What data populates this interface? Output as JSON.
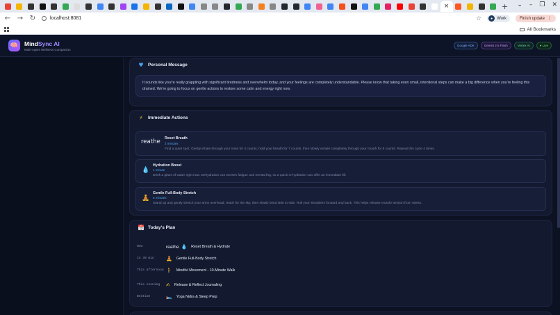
{
  "browser": {
    "url": "localhost:8081",
    "profile_label": "Work",
    "finish_update_label": "Finish update",
    "all_bookmarks_label": "All Bookmarks",
    "tab_favicon_colors": [
      "#ea4335",
      "#f4b400",
      "#333333",
      "#111111",
      "#333333",
      "#34a853",
      "#dddddd",
      "#333333",
      "#4285f4",
      "#333333",
      "#a142f4",
      "#1a73e8",
      "#f4b400",
      "#333333",
      "#0a66c2",
      "#111111",
      "#4285f4",
      "#888888",
      "#888888",
      "#24292f",
      "#34a853",
      "#888888",
      "#f48024",
      "#888888",
      "#24292f",
      "#24292f",
      "#4285f4",
      "#f06292",
      "#4285f4",
      "#f4511e",
      "#111111",
      "#4285f4",
      "#34a853",
      "#e91e63",
      "#ff0000",
      "#ea4335",
      "#333333",
      "#ffffff",
      "#ff5722",
      "#f4b400",
      "#333333",
      "#34a853"
    ],
    "active_tab_close": "×"
  },
  "app": {
    "name_part1": "Mind",
    "name_part2": "Sync AI",
    "subtitle": "Multi-Agent Wellness Companion",
    "badges": [
      "Google ADK",
      "Gemini 2.5 Flash",
      "Vertex AI",
      "● Live"
    ]
  },
  "personal_message": {
    "title": "Personal Message",
    "icon": "blue-heart-icon",
    "text": "It sounds like you're really grappling with significant tiredness and overwhelm today, and your feelings are completely understandable. Please know that taking even small, intentional steps can make a big difference when you're feeling this drained. We're going to focus on gentle actions to restore some calm and energy right now."
  },
  "immediate_actions": {
    "title": "Immediate Actions",
    "icon": "lightning-icon",
    "items": [
      {
        "icon_text": "reathe",
        "title": "Reset Breath",
        "duration": "2 minutes",
        "description": "Find a quiet spot. Gently inhale through your nose for 4 counts, hold your breath for 7 counts, then slowly exhale completely through your mouth for 8 counts. Repeat this cycle 4 times."
      },
      {
        "icon": "droplet-icon",
        "title": "Hydration Boost",
        "duration": "1 minute",
        "description": "Drink a glass of water right now. Dehydration can worsen fatigue and mental fog, so a quick re-hydration can offer an immediate lift."
      },
      {
        "icon": "yoga-icon",
        "title": "Gentle Full-Body Stretch",
        "duration": "5 minutes",
        "description": "Stand up and gently stretch your arms overhead, reach for the sky, then slowly bend side to side. Roll your shoulders forward and back. This helps release muscle tension from stress."
      }
    ]
  },
  "todays_plan": {
    "title": "Today's Plan",
    "icon": "calendar-icon",
    "rows": [
      {
        "time": "Now",
        "icon_text": "reathe",
        "icon": "droplet-icon",
        "label": "Reset Breath & Hydrate"
      },
      {
        "time": "In 30 min",
        "icon": "yoga-icon",
        "label": "Gentle Full-Body Stretch"
      },
      {
        "time": "This afternoon",
        "icon": "walking-icon",
        "label": "Mindful Movement - 10-Minute Walk"
      },
      {
        "time": "This evening",
        "icon": "writing-hand-icon",
        "label": "Release & Reflect Journaling"
      },
      {
        "time": "Bedtime",
        "icon": "bed-icon",
        "label": "Yoga Nidra & Sleep Prep"
      }
    ]
  }
}
